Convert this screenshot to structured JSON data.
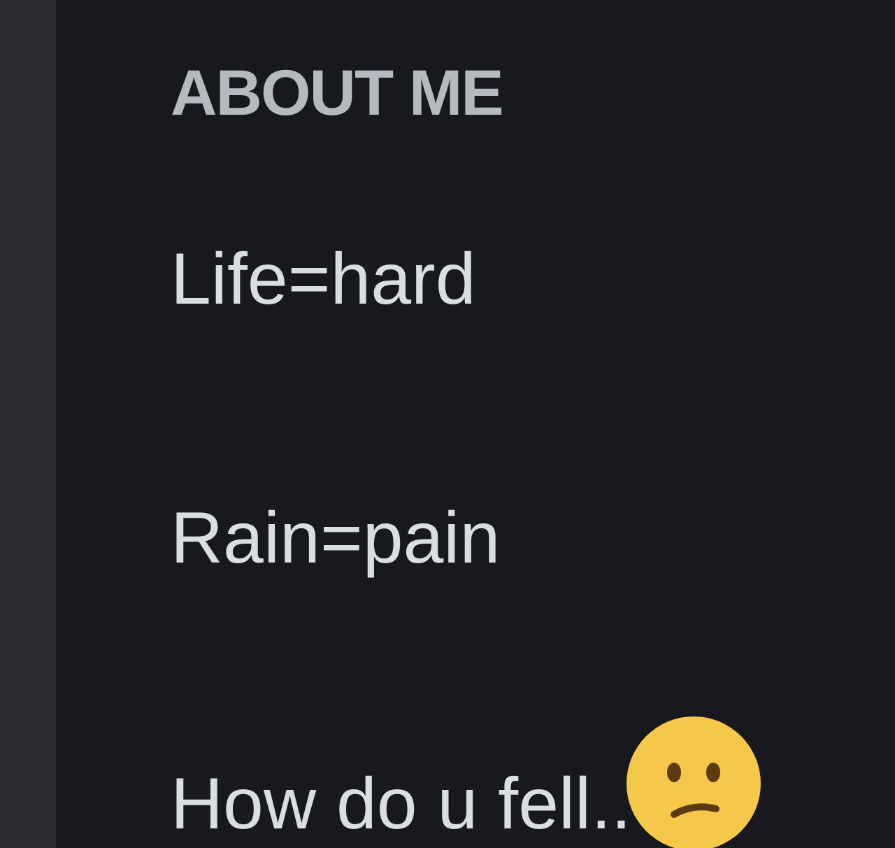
{
  "section": {
    "heading": "ABOUT ME",
    "lines": [
      "Life=hard",
      "Rain=pain",
      "How do u fell.."
    ]
  }
}
